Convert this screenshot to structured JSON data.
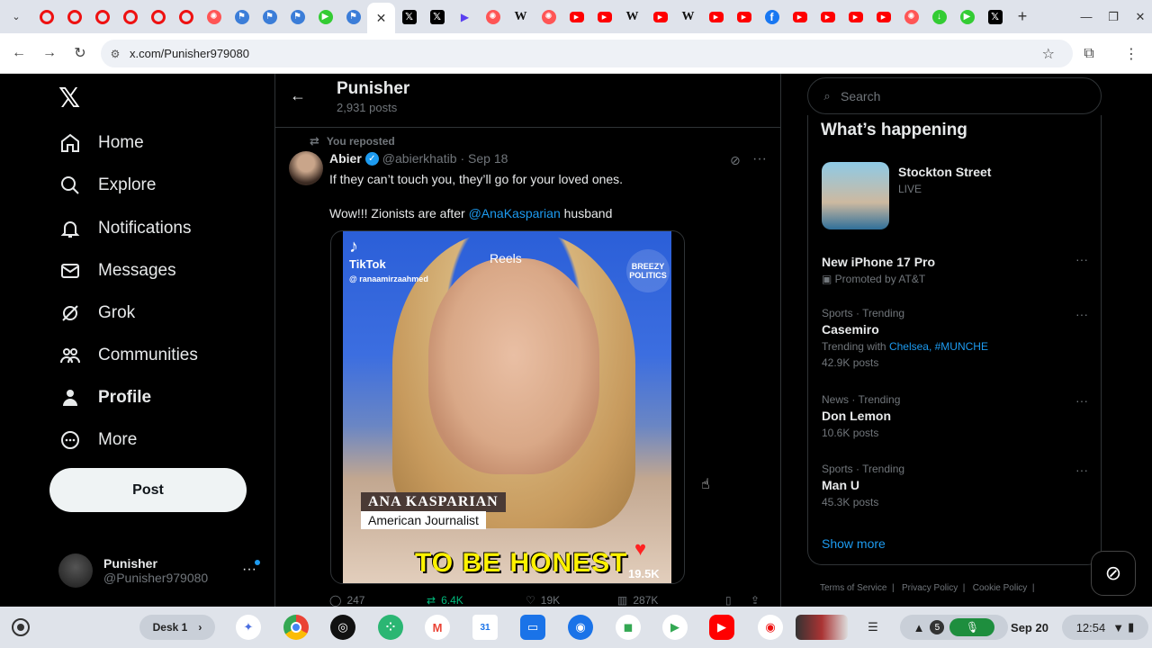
{
  "browser": {
    "url": "x.com/Punisher979080",
    "tab_icons": [
      "ring",
      "ring",
      "ring",
      "ring",
      "ring",
      "ring",
      "pink",
      "blue",
      "blue",
      "blue",
      "green",
      "blue",
      "active",
      "x",
      "x",
      "purple",
      "pink",
      "wiki",
      "pink",
      "yt",
      "yt",
      "wiki",
      "yt",
      "wiki",
      "yt",
      "yt",
      "fb",
      "yt",
      "yt",
      "yt",
      "yt",
      "pink",
      "green",
      "green",
      "x"
    ]
  },
  "nav": {
    "items": [
      {
        "label": "Home",
        "icon": "home-icon"
      },
      {
        "label": "Explore",
        "icon": "search-icon"
      },
      {
        "label": "Notifications",
        "icon": "bell-icon"
      },
      {
        "label": "Messages",
        "icon": "mail-icon"
      },
      {
        "label": "Grok",
        "icon": "grok-icon"
      },
      {
        "label": "Communities",
        "icon": "people-icon"
      },
      {
        "label": "Profile",
        "icon": "person-icon"
      },
      {
        "label": "More",
        "icon": "more-circle-icon"
      }
    ],
    "post_label": "Post",
    "account": {
      "name": "Punisher",
      "handle": "@Punisher979080"
    }
  },
  "profile_header": {
    "name": "Punisher",
    "post_count": "2,931 posts"
  },
  "tweet": {
    "repost_label": "You reposted",
    "author": "Abier",
    "handle": "@abierkhatib",
    "date": "· Sep 18",
    "line1": "If they can’t touch you, they’ll go for your loved ones.",
    "line2_prefix": "Wow!!! Zionists are after ",
    "mention": "@AnaKasparian",
    "line2_suffix": " husband",
    "video": {
      "tiktok": "TikTok",
      "tiktok_handle": "@ ranaamirzaahmed",
      "reels": "Reels",
      "watermark": "BREEZY POLITICS",
      "name_lower": "ANA KASPARIAN",
      "title_lower": "American Journalist",
      "caption": "TO BE HONEST",
      "likes": "19.5K"
    },
    "actions": {
      "replies": "247",
      "reposts": "6.4K",
      "likes": "19K",
      "views": "287K"
    }
  },
  "sidebar": {
    "search_placeholder": "Search",
    "title": "What’s happening",
    "live": {
      "title": "Stockton Street",
      "badge": "LIVE"
    },
    "trends": [
      {
        "category": "",
        "title": "New iPhone 17 Pro",
        "meta": "Promoted by AT&T"
      },
      {
        "category": "Sports · Trending",
        "title": "Casemiro",
        "meta_prefix": "Trending with ",
        "meta_links": "Chelsea, #MUNCHE",
        "meta2": "42.9K posts"
      },
      {
        "category": "News · Trending",
        "title": "Don Lemon",
        "meta": "10.6K posts"
      },
      {
        "category": "Sports · Trending",
        "title": "Man U",
        "meta": "45.3K posts"
      }
    ],
    "show_more": "Show more",
    "footer": [
      "Terms of Service",
      "Privacy Policy",
      "Cookie Policy"
    ]
  },
  "shelf": {
    "desk_label": "Desk 1",
    "notif_count": "5",
    "date": "Sep 20",
    "time": "12:54"
  },
  "colors": {
    "accent": "#1d9bf0",
    "repost_green": "#00ba7c"
  }
}
